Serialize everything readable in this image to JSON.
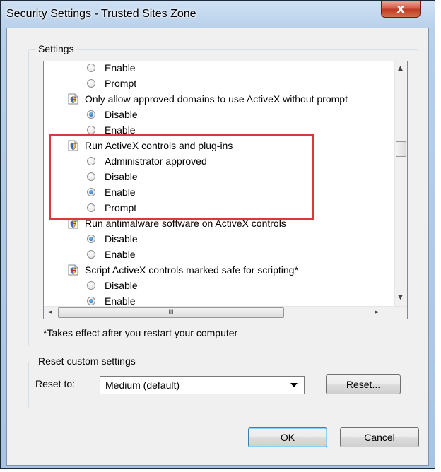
{
  "window": {
    "title": "Security Settings - Trusted Sites Zone",
    "close_glyph": "x"
  },
  "settings_group": {
    "label": "Settings"
  },
  "list": [
    {
      "kind": "option",
      "label": "Enable",
      "checked": false
    },
    {
      "kind": "option",
      "label": "Prompt",
      "checked": false
    },
    {
      "kind": "category",
      "label": "Only allow approved domains to use ActiveX without prompt",
      "icon": "security-settings-icon"
    },
    {
      "kind": "option",
      "label": "Disable",
      "checked": true
    },
    {
      "kind": "option",
      "label": "Enable",
      "checked": false
    },
    {
      "kind": "category",
      "label": "Run ActiveX controls and plug-ins",
      "icon": "security-settings-icon"
    },
    {
      "kind": "option",
      "label": "Administrator approved",
      "checked": false
    },
    {
      "kind": "option",
      "label": "Disable",
      "checked": false
    },
    {
      "kind": "option",
      "label": "Enable",
      "checked": true
    },
    {
      "kind": "option",
      "label": "Prompt",
      "checked": false
    },
    {
      "kind": "category",
      "label": "Run antimalware software on ActiveX controls",
      "icon": "security-settings-icon"
    },
    {
      "kind": "option",
      "label": "Disable",
      "checked": true
    },
    {
      "kind": "option",
      "label": "Enable",
      "checked": false
    },
    {
      "kind": "category",
      "label": "Script ActiveX controls marked safe for scripting*",
      "icon": "security-settings-icon"
    },
    {
      "kind": "option",
      "label": "Disable",
      "checked": false
    },
    {
      "kind": "option",
      "label": "Enable",
      "checked": true
    }
  ],
  "scroll": {
    "up": "▲",
    "down": "▼",
    "left": "◄",
    "right": "►",
    "grip": "III"
  },
  "note": "*Takes effect after you restart your computer",
  "reset_group": {
    "label": "Reset custom settings",
    "reset_to_label": "Reset to:",
    "selected": "Medium (default)",
    "reset_button": "Reset..."
  },
  "buttons": {
    "ok": "OK",
    "cancel": "Cancel"
  },
  "colors": {
    "highlight": "#d9393a",
    "radio_selected": "#1c5aa8",
    "close_button": "#c03b22"
  }
}
